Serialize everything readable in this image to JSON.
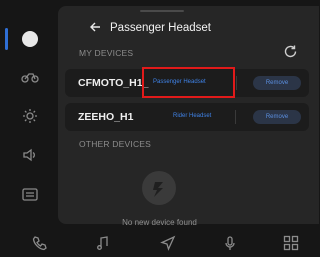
{
  "header": {
    "title": "Passenger Headset"
  },
  "sections": {
    "my_devices": "MY DEVICES",
    "other_devices": "OTHER DEVICES"
  },
  "devices": [
    {
      "name": "CFMOTO_H1_",
      "role_link": "Passenger Headset",
      "remove_label": "Remove"
    },
    {
      "name": "ZEEHO_H1",
      "role_link": "Rider Headset",
      "remove_label": "Remove"
    }
  ],
  "empty_state": {
    "message": "No new device found"
  },
  "rail": {
    "items": [
      "bluetooth-icon",
      "motorcycle-icon",
      "brightness-icon",
      "volume-icon",
      "keyboard-icon"
    ]
  },
  "bottom_nav": {
    "items": [
      "phone-icon",
      "music-icon",
      "navigation-icon",
      "microphone-icon",
      "apps-grid-icon"
    ]
  },
  "colors": {
    "accent": "#3f82e6",
    "highlight": "#e11a1a",
    "panel": "#262626",
    "background": "#161616"
  }
}
